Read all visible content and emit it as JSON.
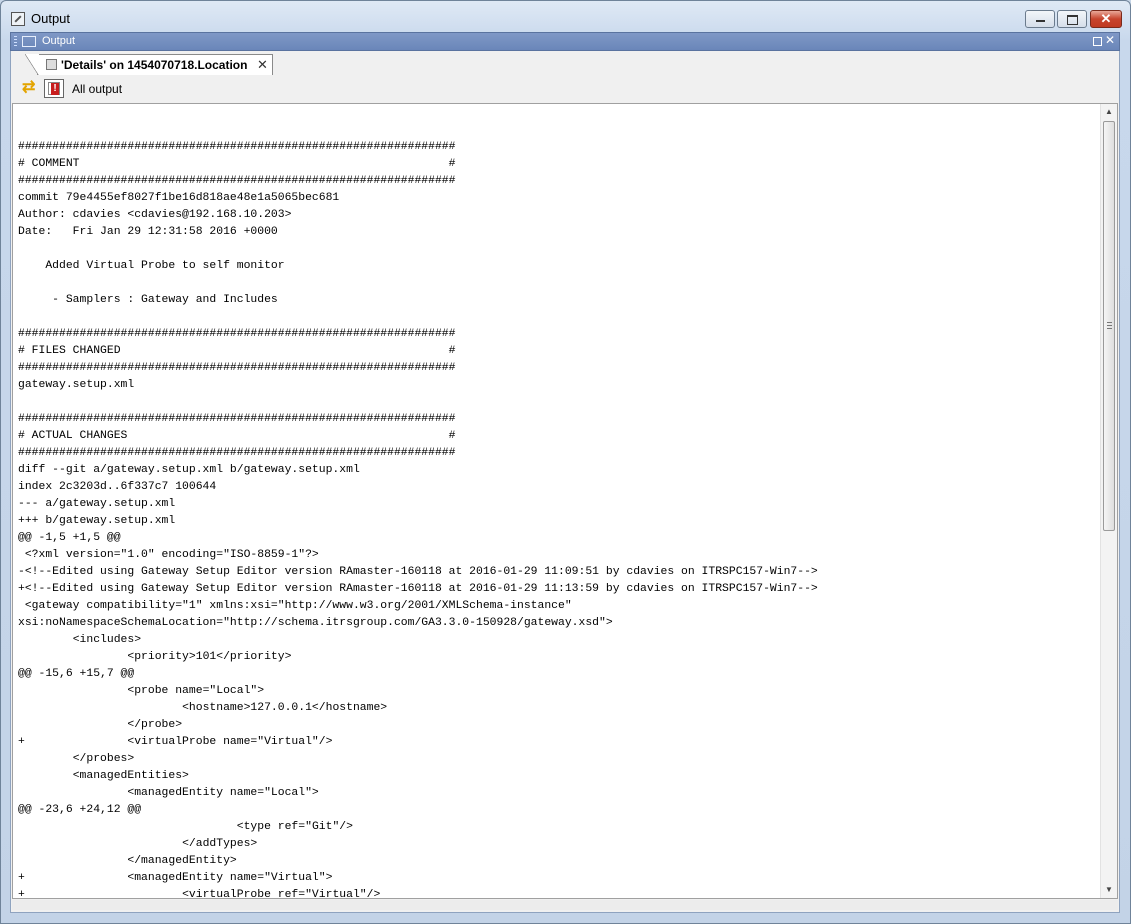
{
  "window": {
    "title": "Output"
  },
  "panel": {
    "title": "Output"
  },
  "tab": {
    "label": "'Details' on 1454070718.Location"
  },
  "toolbar": {
    "filter_label": "All output"
  },
  "output": {
    "text": "\n################################################################\n# COMMENT                                                      #\n################################################################\ncommit 79e4455ef8027f1be16d818ae48e1a5065bec681\nAuthor: cdavies <cdavies@192.168.10.203>\nDate:   Fri Jan 29 12:31:58 2016 +0000\n\n    Added Virtual Probe to self monitor\n\n     - Samplers : Gateway and Includes\n\n################################################################\n# FILES CHANGED                                                #\n################################################################\ngateway.setup.xml\n\n################################################################\n# ACTUAL CHANGES                                               #\n################################################################\ndiff --git a/gateway.setup.xml b/gateway.setup.xml\nindex 2c3203d..6f337c7 100644\n--- a/gateway.setup.xml\n+++ b/gateway.setup.xml\n@@ -1,5 +1,5 @@\n <?xml version=\"1.0\" encoding=\"ISO-8859-1\"?>\n-<!--Edited using Gateway Setup Editor version RAmaster-160118 at 2016-01-29 11:09:51 by cdavies on ITRSPC157-Win7-->\n+<!--Edited using Gateway Setup Editor version RAmaster-160118 at 2016-01-29 11:13:59 by cdavies on ITRSPC157-Win7-->\n <gateway compatibility=\"1\" xmlns:xsi=\"http://www.w3.org/2001/XMLSchema-instance\"\nxsi:noNamespaceSchemaLocation=\"http://schema.itrsgroup.com/GA3.3.0-150928/gateway.xsd\">\n \t<includes>\n \t\t<priority>101</priority>\n@@ -15,6 +15,7 @@\n \t\t<probe name=\"Local\">\n \t\t\t<hostname>127.0.0.1</hostname>\n \t\t</probe>\n+\t\t<virtualProbe name=\"Virtual\"/>\n \t</probes>\n \t<managedEntities>\n \t\t<managedEntity name=\"Local\">\n@@ -23,6 +24,12 @@\n \t\t\t\t<type ref=\"Git\"/>\n \t\t\t</addTypes>\n \t\t</managedEntity>\n+\t\t<managedEntity name=\"Virtual\">\n+\t\t\t<virtualProbe ref=\"Virtual\"/>\n+\t\t\t<addTypes>"
  }
}
